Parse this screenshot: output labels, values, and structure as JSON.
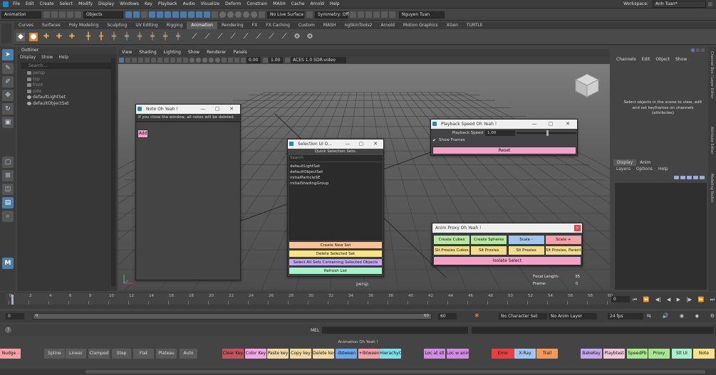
{
  "menubar": {
    "items": [
      "File",
      "Edit",
      "Create",
      "Select",
      "Modify",
      "Display",
      "Windows",
      "Key",
      "Playback",
      "Audio",
      "Visualize",
      "Deform",
      "Constrain",
      "MASH",
      "Cache",
      "Arnold",
      "Help"
    ],
    "workspace_label": "Workspace:",
    "workspace_value": "Anh Tuan*"
  },
  "statusline": {
    "mode_menu": "Animation",
    "selection_mode": "Objects",
    "live_surface": "No Live Surface",
    "symmetry": "Symmetry: Off",
    "user": "Nguyen Tuan"
  },
  "shelf": {
    "tabs": [
      "Curves",
      "Surfaces",
      "Poly Modeling",
      "Sculpting",
      "UV Editing",
      "Rigging",
      "Animation",
      "Rendering",
      "FX",
      "FX Caching",
      "Custom",
      "MASH",
      "ngSkinTools2",
      "Arnold",
      "Motion Graphics",
      "XGen",
      "TURTLE"
    ],
    "active_tab": "Animation"
  },
  "outliner": {
    "title": "Outliner",
    "menu": [
      "Display",
      "Show",
      "Help"
    ],
    "search_placeholder": "Search...",
    "items": [
      {
        "label": "persp",
        "dim": true
      },
      {
        "label": "top",
        "dim": true
      },
      {
        "label": "front",
        "dim": true
      },
      {
        "label": "side",
        "dim": true
      },
      {
        "label": "defaultLightSet",
        "dim": false
      },
      {
        "label": "defaultObjectSet",
        "dim": false
      }
    ]
  },
  "viewport": {
    "menu": [
      "View",
      "Shading",
      "Lighting",
      "Show",
      "Renderer",
      "Panels"
    ],
    "exposure": "0.00",
    "gamma": "1.00",
    "colorspace": "ACES 1.0 SDR-video (sRGB)",
    "camera": "persp",
    "focal_length_label": "Focal Length:",
    "focal_length_value": "35",
    "frame_label": "Frame:",
    "frame_value": "0"
  },
  "channelbox": {
    "menu": [
      "Channels",
      "Edit",
      "Object",
      "Show"
    ],
    "message": "Select objects in the scene to view, edit and set keyframes on channels (attributes)"
  },
  "layers": {
    "tabs": [
      "Display",
      "Anim"
    ],
    "menu": [
      "Layers",
      "Options",
      "Help"
    ]
  },
  "sidetabs": [
    "Channel Box / Layer Editor",
    "Attribute Editor",
    "Modeling Toolkit"
  ],
  "note_window": {
    "title": "Note Oh Yeah !",
    "message": "If you close the window, all notes will be deleted.",
    "add_label": "Add",
    "add_color": "#f4a0c9"
  },
  "selection_window": {
    "title": "Selection UI O...",
    "header": "Quick Selection Sets:",
    "search_placeholder": "Search",
    "sets": [
      "defaultLightSet",
      "defaultObjectSet",
      "initialParticleSE",
      "initialShadingGroup"
    ],
    "buttons": [
      {
        "label": "Create New Set",
        "color": "#f6c49a"
      },
      {
        "label": "Delete Selected Set",
        "color": "#f6e38a"
      },
      {
        "label": "Select All Sets Containing Selected Objects",
        "color": "#c4a9f0"
      },
      {
        "label": "Refresh List",
        "color": "#a8f0c8"
      }
    ]
  },
  "playback_window": {
    "title": "Playback Speed Oh Yeah !",
    "speed_label": "Playback Speed",
    "speed_value": "1.00",
    "speed_slider": 0.5,
    "show_frames_label": "Show Frames",
    "show_frames_checked": true,
    "reset_label": "Reset",
    "reset_color": "#f4a0c9"
  },
  "anim_proxy_window": {
    "title": "Anim Proxy Oh Yeah !",
    "row1": [
      {
        "label": "Create Cubes",
        "color": "#b7e8a0"
      },
      {
        "label": "Create Spheres",
        "color": "#b7e8a0"
      },
      {
        "label": "Scale -",
        "color": "#9ec6ef"
      },
      {
        "label": "Scale +",
        "color": "#f4a0a8"
      }
    ],
    "row2": [
      {
        "label": "Slt Proxies Cubes",
        "color": "#f2dc8c"
      },
      {
        "label": "Slt Proxies Spheres",
        "color": "#f2dc8c"
      },
      {
        "label": "Slt Proxies",
        "color": "#f2dc8c"
      },
      {
        "label": "Slt Proxies, Parent",
        "color": "#f2dc8c"
      }
    ],
    "isolate_label": "Isolate Select",
    "isolate_color": "#f4a0c9",
    "close_color": "#e04646"
  },
  "timeslider": {
    "ticks": [
      "0",
      "2",
      "4",
      "6",
      "8",
      "10",
      "12",
      "14",
      "16",
      "18",
      "20",
      "22",
      "24",
      "26",
      "28",
      "30",
      "32",
      "34",
      "36",
      "38",
      "40",
      "42",
      "44",
      "46",
      "48",
      "50",
      "52",
      "54",
      "56",
      "58",
      "60"
    ],
    "current_frame": "0",
    "range_start": "0",
    "range_inner_start": "0",
    "range_inner_end": "60",
    "range_end": "60",
    "character_set": "No Character Set",
    "anim_layer": "No Anim Layer",
    "fps": "24 fps"
  },
  "cmdline": {
    "label": "MEL"
  },
  "helpline": "Animation Oh Yeah !",
  "bottom_shelf": [
    {
      "label": "Nudge -",
      "color": "#f4a0a8"
    },
    {
      "label": "Spline",
      "color": "#5a5a5a"
    },
    {
      "label": "Linear",
      "color": "#5a5a5a"
    },
    {
      "label": "Clamped",
      "color": "#5a5a5a"
    },
    {
      "label": "Step",
      "color": "#5a5a5a"
    },
    {
      "label": "Flat",
      "color": "#5a5a5a"
    },
    {
      "label": "Plateau",
      "color": "#5a5a5a"
    },
    {
      "label": "Auto",
      "color": "#5a5a5a"
    },
    {
      "label": "Clear Key",
      "color": "#c2545c"
    },
    {
      "label": "Color Key",
      "color": "#f2a6e6"
    },
    {
      "label": "Paste key",
      "color": "#f6d9a0"
    },
    {
      "label": "Copy key",
      "color": "#f6d9a0"
    },
    {
      "label": "Delete key",
      "color": "#f6d9a0"
    },
    {
      "label": "-Ibtween",
      "color": "#6aa9f0"
    },
    {
      "label": "+Ibtween",
      "color": "#f4a0a8"
    },
    {
      "label": "HierachyCv",
      "color": "#7ee0e8"
    },
    {
      "label": "Loc at slt",
      "color": "#d58ae6"
    },
    {
      "label": "Loc w anim",
      "color": "#d58ae6"
    },
    {
      "label": "Error",
      "color": "#e84040"
    },
    {
      "label": "X-Ray",
      "color": "#9ec6ef"
    },
    {
      "label": "Trail",
      "color": "#f29a5a"
    },
    {
      "label": "BakeKey",
      "color": "#c4a9f0"
    },
    {
      "label": "Playblast",
      "color": "#f6c7d8"
    },
    {
      "label": "SpeedPb",
      "color": "#a6e890"
    },
    {
      "label": "Proxy",
      "color": "#a6e890"
    },
    {
      "label": "Slt UI",
      "color": "#a8f0c8"
    },
    {
      "label": "Note",
      "color": "#f6e38a"
    }
  ]
}
